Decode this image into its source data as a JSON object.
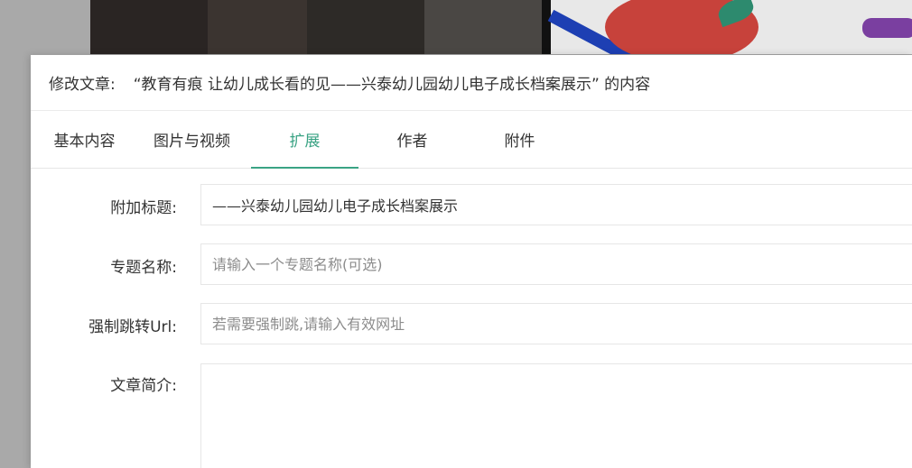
{
  "dialog": {
    "title_label": "修改文章:",
    "title_text": "“教育有痕 让幼儿成长看的见——兴泰幼儿园幼儿电子成长档案展示” 的内容"
  },
  "tabs": [
    {
      "label": "基本内容",
      "active": false
    },
    {
      "label": "图片与视频",
      "active": false
    },
    {
      "label": "扩展",
      "active": true
    },
    {
      "label": "作者",
      "active": false
    },
    {
      "label": "附件",
      "active": false
    }
  ],
  "form": {
    "subtitle_label": "附加标题:",
    "subtitle_value": "——兴泰幼儿园幼儿电子成长档案展示",
    "topic_label": "专题名称:",
    "topic_placeholder": "请输入一个专题名称(可选)",
    "redirect_label": "强制跳转Url:",
    "redirect_placeholder": "若需要强制跳,请输入有效网址",
    "summary_label": "文章简介:"
  },
  "colors": {
    "accent": "#3aa384",
    "overlay": "#a6a6a6"
  }
}
